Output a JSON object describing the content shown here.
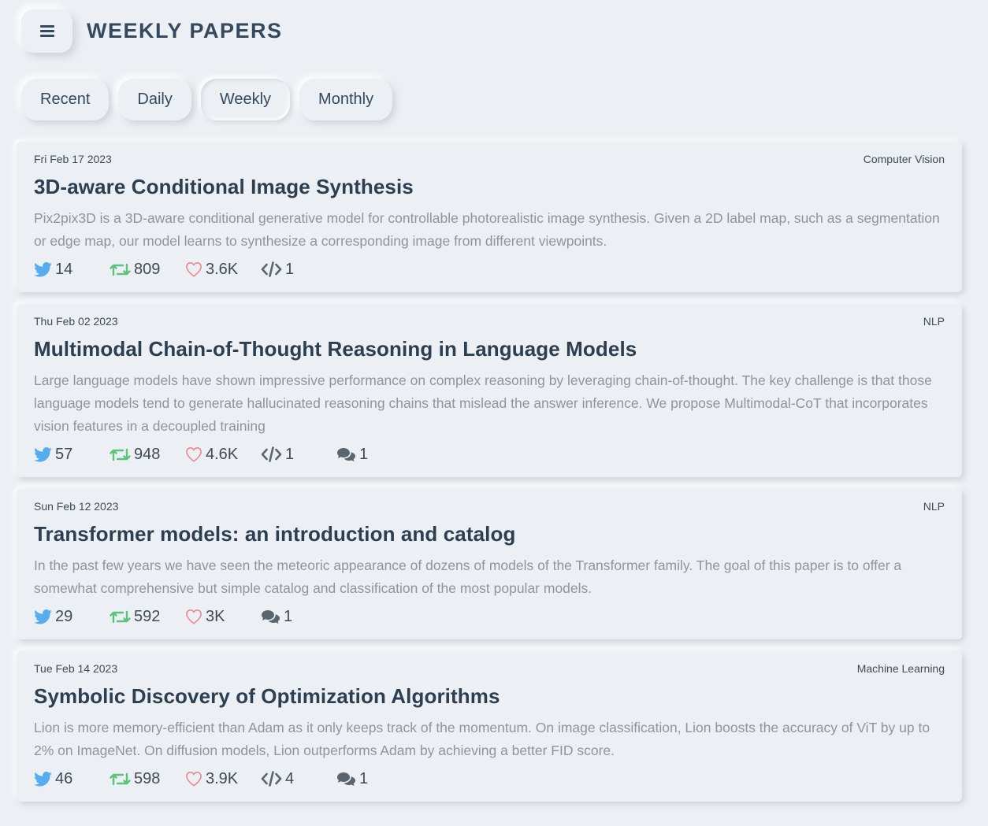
{
  "header": {
    "title": "WEEKLY PAPERS",
    "menu_icon": "hamburger-icon"
  },
  "tabs": [
    {
      "label": "Recent",
      "active": false
    },
    {
      "label": "Daily",
      "active": false
    },
    {
      "label": "Weekly",
      "active": true
    },
    {
      "label": "Monthly",
      "active": false
    }
  ],
  "colors": {
    "twitter": "#55acee",
    "retweet": "#5cc47a",
    "like": "#e88a8f",
    "icon_gray": "#5a6570"
  },
  "papers": [
    {
      "date": "Fri Feb 17 2023",
      "category": "Computer Vision",
      "title": "3D-aware Conditional Image Synthesis",
      "abstract": "Pix2pix3D is a 3D-aware conditional generative model for controllable photorealistic image synthesis. Given a 2D label map, such as a segmentation or edge map, our model learns to synthesize a corresponding image from different viewpoints.",
      "tweets": "14",
      "retweets": "809",
      "likes": "3.6K",
      "code": "1",
      "comments": null
    },
    {
      "date": "Thu Feb 02 2023",
      "category": "NLP",
      "title": "Multimodal Chain-of-Thought Reasoning in Language Models",
      "abstract": "Large language models have shown impressive performance on complex reasoning by leveraging chain-of-thought. The key challenge is that those language models tend to generate hallucinated reasoning chains that mislead the answer inference. We propose Multimodal-CoT that incorporates vision features in a decoupled training",
      "tweets": "57",
      "retweets": "948",
      "likes": "4.6K",
      "code": "1",
      "comments": "1"
    },
    {
      "date": "Sun Feb 12 2023",
      "category": "NLP",
      "title": "Transformer models: an introduction and catalog",
      "abstract": "In the past few years we have seen the meteoric appearance of dozens of models of the Transformer family. The goal of this paper is to offer a somewhat comprehensive but simple catalog and classification of the most popular models.",
      "tweets": "29",
      "retweets": "592",
      "likes": "3K",
      "code": null,
      "comments": "1"
    },
    {
      "date": "Tue Feb 14 2023",
      "category": "Machine Learning",
      "title": "Symbolic Discovery of Optimization Algorithms",
      "abstract": "Lion is more memory-efficient than Adam as it only keeps track of the momentum. On image classification, Lion boosts the accuracy of ViT by up to 2% on ImageNet. On diffusion models, Lion outperforms Adam by achieving a better FID score.",
      "tweets": "46",
      "retweets": "598",
      "likes": "3.9K",
      "code": "4",
      "comments": "1"
    }
  ]
}
